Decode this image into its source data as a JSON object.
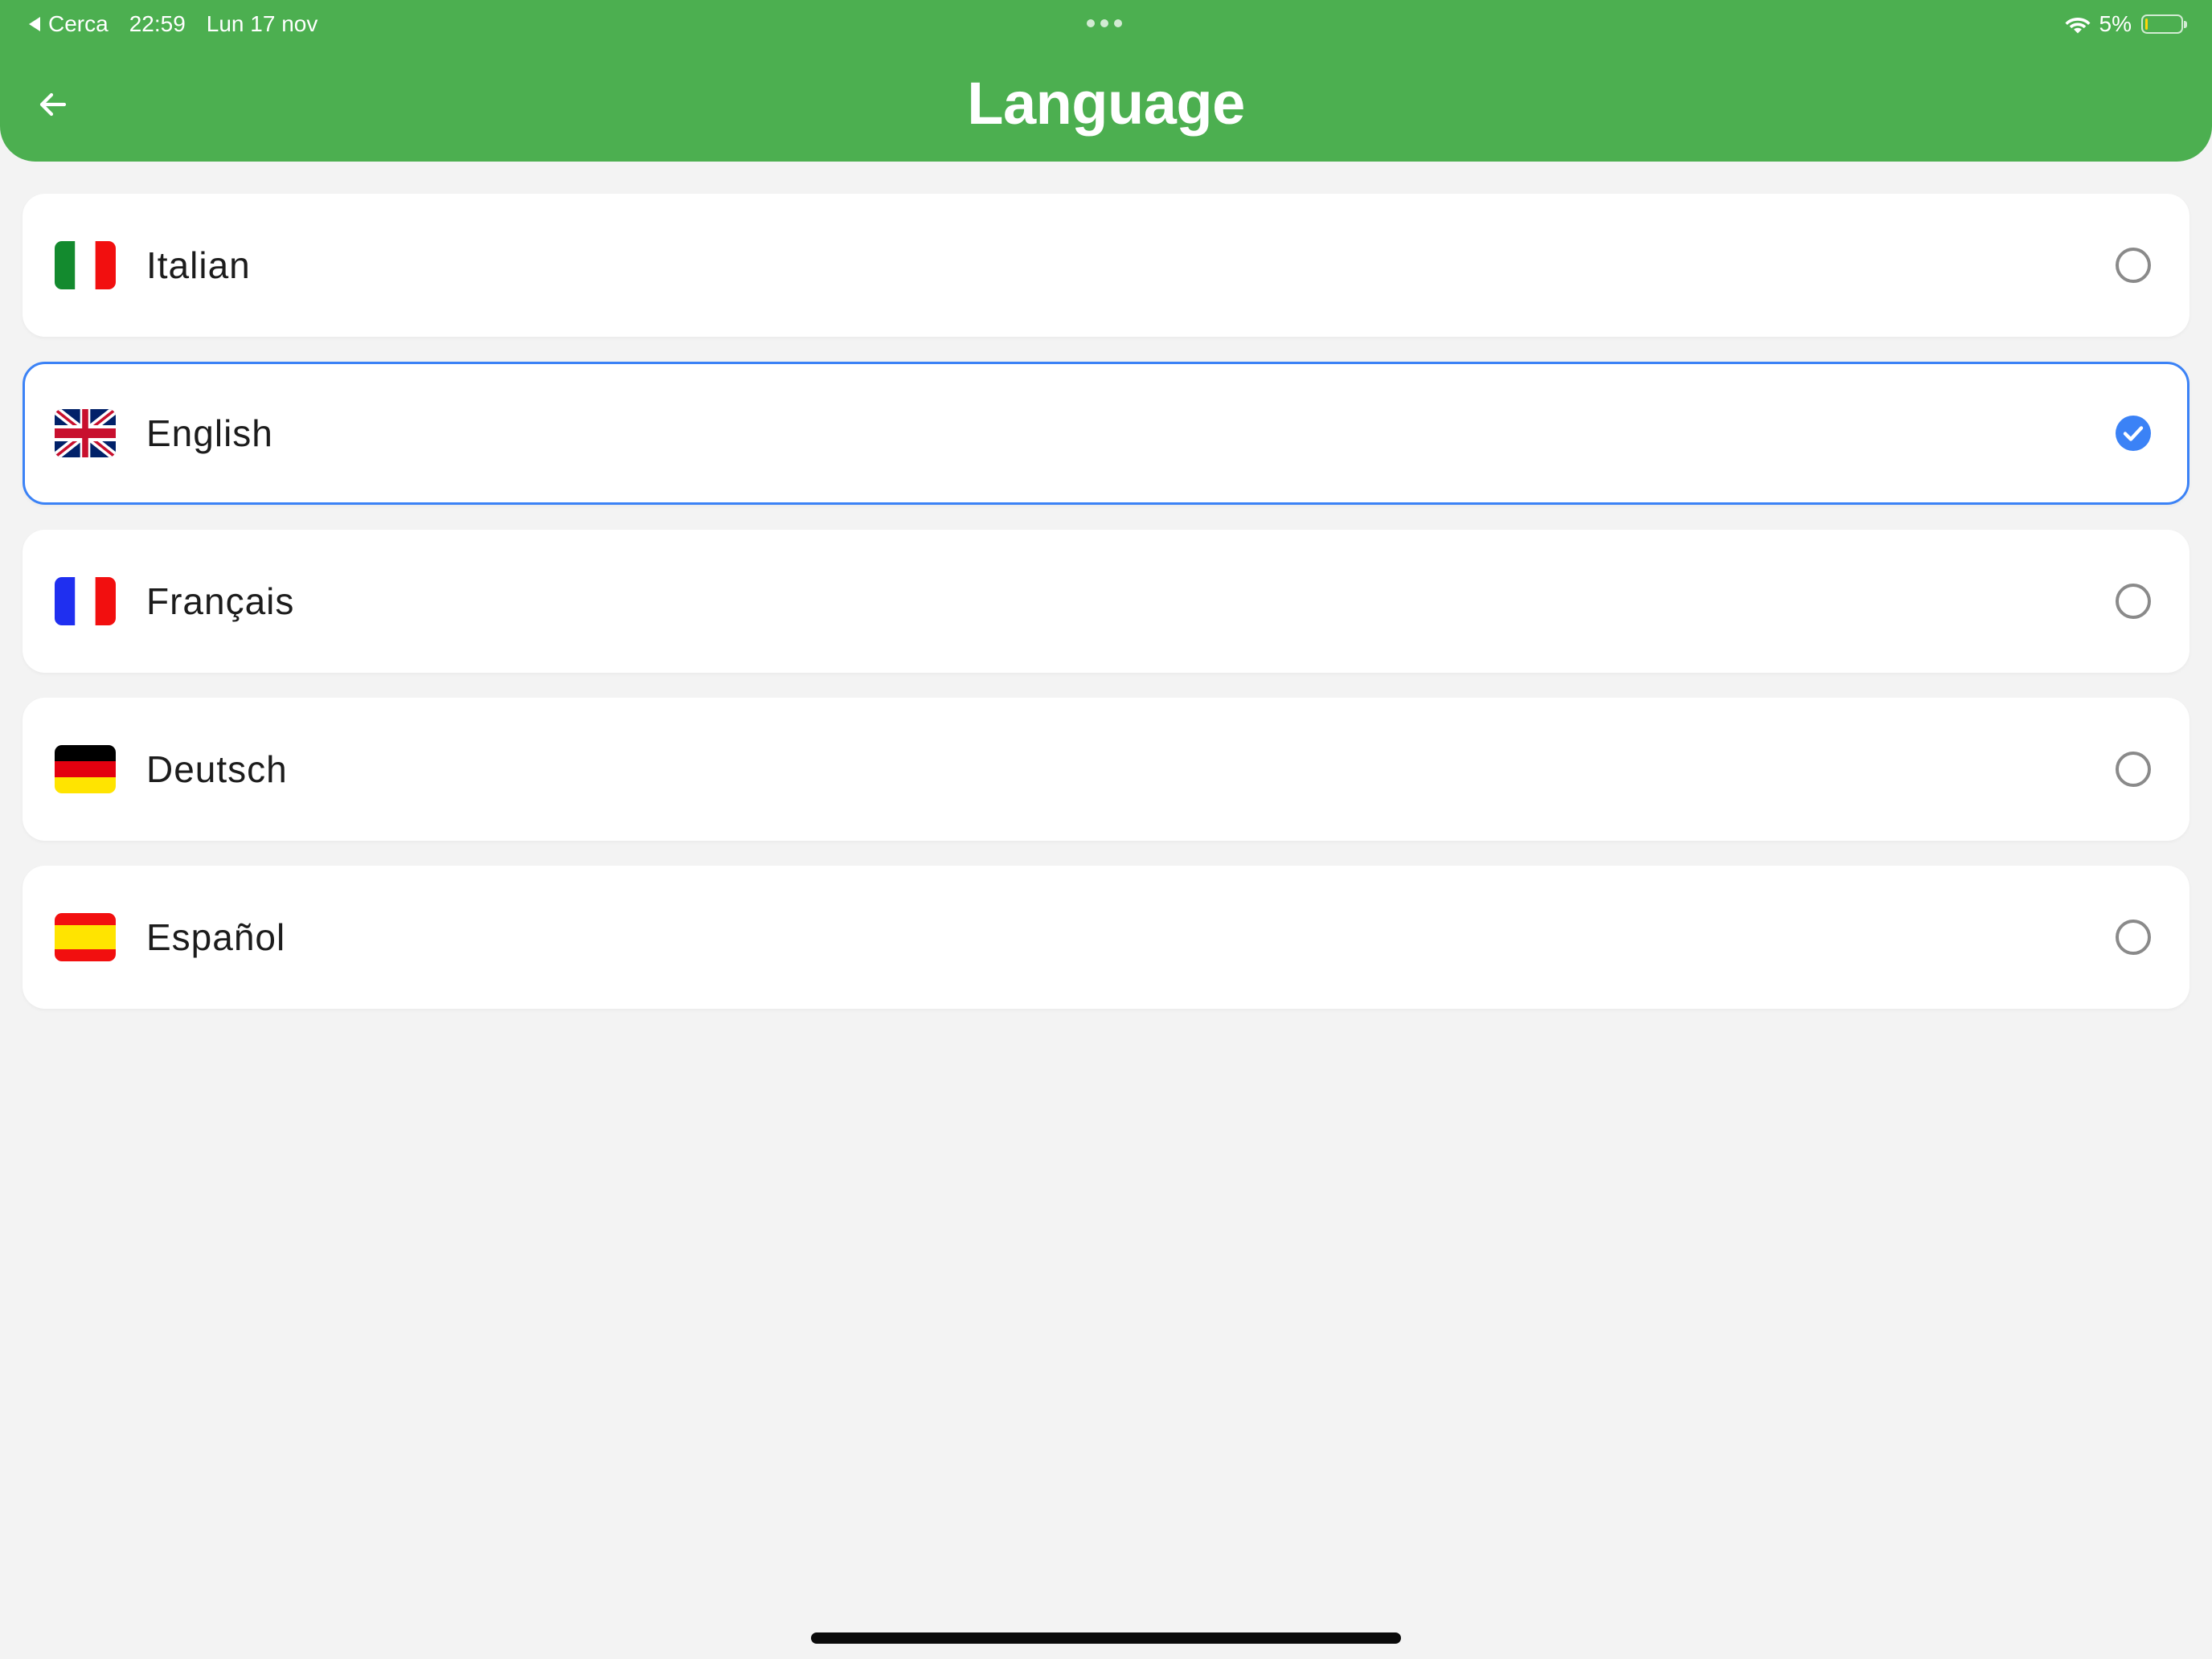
{
  "status_bar": {
    "back_app": "Cerca",
    "time": "22:59",
    "date": "Lun 17 nov",
    "battery_percent": "5%",
    "battery_level_fraction": 0.05
  },
  "header": {
    "title": "Language",
    "background_color": "#4caf50",
    "back_icon": "arrow-left-icon"
  },
  "languages": [
    {
      "label": "Italian",
      "flag": "italy-flag-icon",
      "selected": false
    },
    {
      "label": "English",
      "flag": "uk-flag-icon",
      "selected": true
    },
    {
      "label": "Français",
      "flag": "france-flag-icon",
      "selected": false
    },
    {
      "label": "Deutsch",
      "flag": "germany-flag-icon",
      "selected": false
    },
    {
      "label": "Español",
      "flag": "spain-flag-icon",
      "selected": false
    }
  ],
  "colors": {
    "accent": "#3b82f6",
    "radio_unselected": "#8a8a8a",
    "page_background": "#f3f3f3"
  }
}
